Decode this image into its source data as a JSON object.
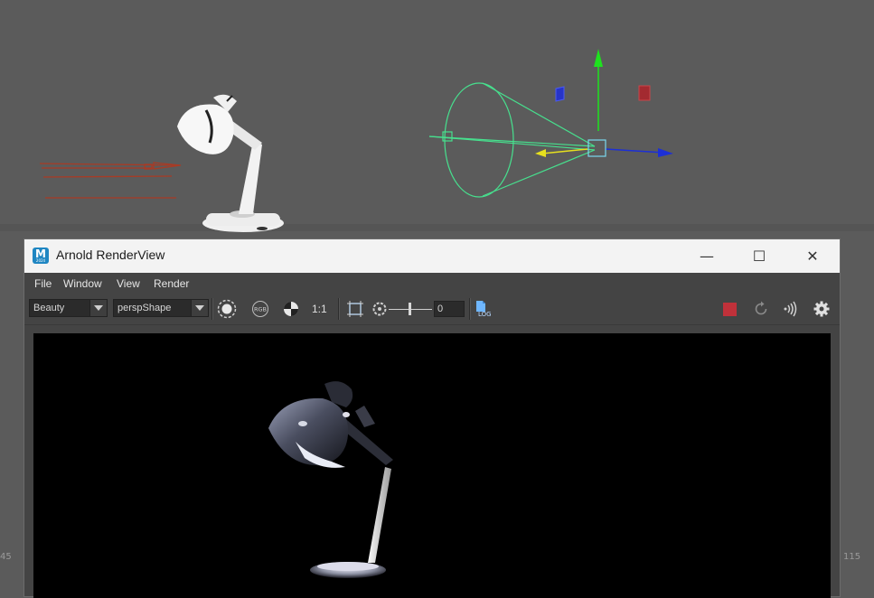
{
  "window": {
    "title": "Arnold RenderView",
    "app_icon_letter": "M",
    "app_icon_sub": "2024",
    "minimize_glyph": "—",
    "maximize_glyph": "☐",
    "close_glyph": "✕"
  },
  "menu": {
    "file": "File",
    "window": "Window",
    "view": "View",
    "render": "Render"
  },
  "toolbar": {
    "aov_value": "Beauty",
    "camera_value": "perspShape",
    "ratio_label": "1:1",
    "exposure_value": "0",
    "exposure_level": 0.45,
    "log_label": "LOG",
    "rgb_label": "RGB"
  },
  "viewport": {
    "ruler_left": "45",
    "ruler_right": "115"
  },
  "colors": {
    "stop_red": "#c0313a",
    "light_green": "#47e08e",
    "y_axis": "#1ee21e",
    "z_axis": "#1c2fd6",
    "arrow_red": "#a83b25"
  }
}
